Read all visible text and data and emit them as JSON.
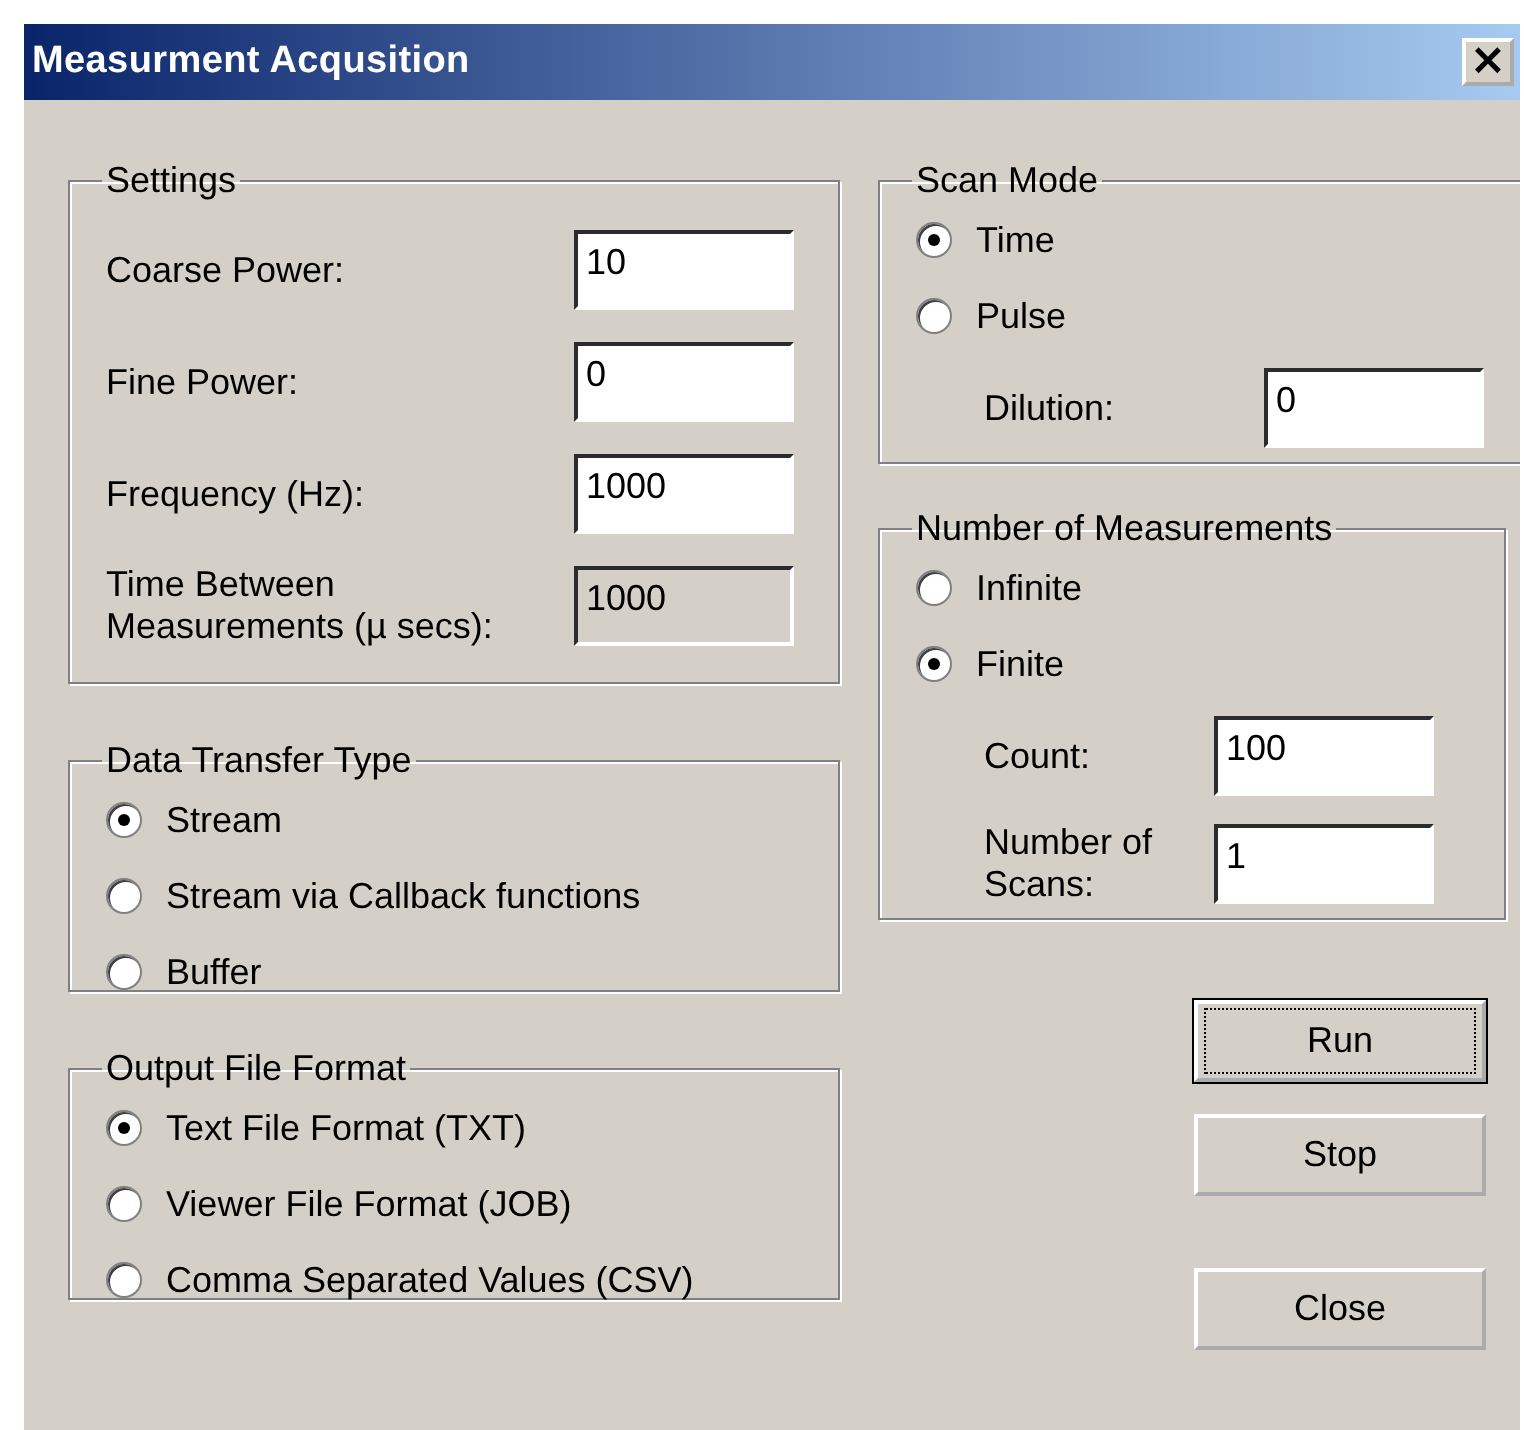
{
  "window": {
    "title": "Measurment Acqusition",
    "close_glyph": "×"
  },
  "settings": {
    "title": "Settings",
    "fields": [
      {
        "label": "Coarse Power:",
        "value": "10",
        "disabled": false
      },
      {
        "label": "Fine Power:",
        "value": "0",
        "disabled": false
      },
      {
        "label": "Frequency (Hz):",
        "value": "1000",
        "disabled": false
      },
      {
        "label": "Time Between Measurements (µ secs):",
        "value": "1000",
        "disabled": true
      }
    ]
  },
  "data_transfer_type": {
    "title": "Data Transfer Type",
    "options": [
      {
        "label": "Stream",
        "selected": true
      },
      {
        "label": "Stream via Callback functions",
        "selected": false
      },
      {
        "label": "Buffer",
        "selected": false
      }
    ]
  },
  "output_file_format": {
    "title": "Output File Format",
    "options": [
      {
        "label": "Text File Format (TXT)",
        "selected": true
      },
      {
        "label": "Viewer File Format (JOB)",
        "selected": false
      },
      {
        "label": "Comma Separated Values (CSV)",
        "selected": false
      }
    ]
  },
  "scan_mode": {
    "title": "Scan Mode",
    "options": [
      {
        "label": "Time",
        "selected": true
      },
      {
        "label": "Pulse",
        "selected": false
      }
    ],
    "fields": [
      {
        "label": "Dilution:",
        "value": "0"
      }
    ]
  },
  "number_of_measurements": {
    "title": "Number of Measurements",
    "options": [
      {
        "label": "Infinite",
        "selected": false
      },
      {
        "label": "Finite",
        "selected": true
      }
    ],
    "fields": [
      {
        "label": "Count:",
        "value": "100"
      },
      {
        "label": "Number of Scans:",
        "value": "1"
      }
    ]
  },
  "buttons": [
    {
      "label": "Run",
      "focused": true
    },
    {
      "label": "Stop",
      "focused": false
    },
    {
      "label": "Close",
      "focused": false
    }
  ]
}
